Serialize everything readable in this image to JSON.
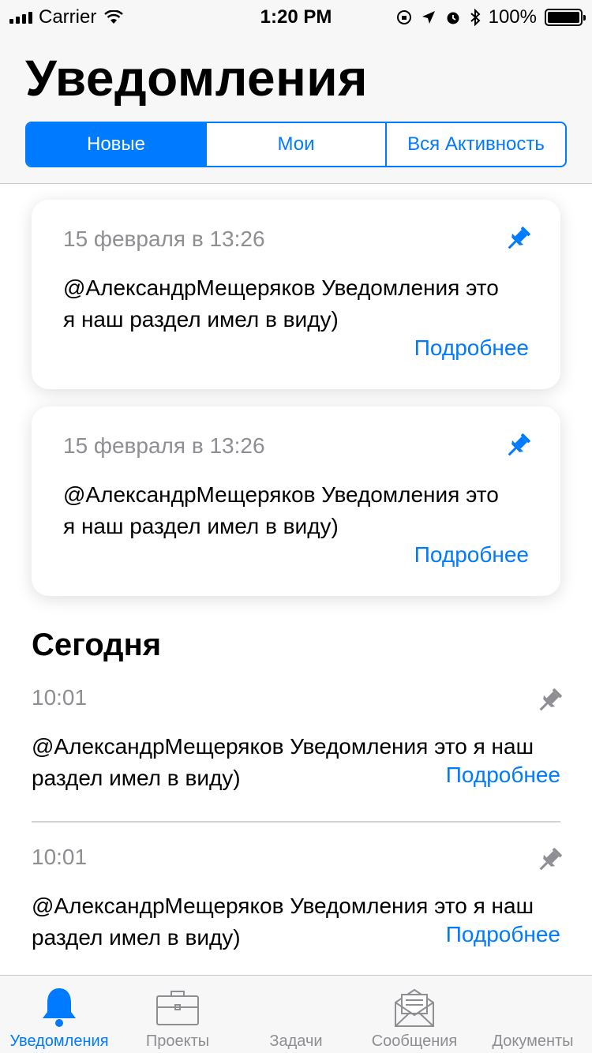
{
  "status_bar": {
    "carrier": "Carrier",
    "time": "1:20 PM",
    "battery": "100%"
  },
  "header": {
    "title": "Уведомления",
    "segments": [
      "Новые",
      "Мои",
      "Вся Активность"
    ],
    "active_segment": "Новые"
  },
  "pinned": [
    {
      "date": "15 февраля в 13:26",
      "text": "@АлександрМещеряков Уведомления это я наш раздел имел в виду)",
      "more": "Подробнее"
    },
    {
      "date": "15 февраля в 13:26",
      "text": "@АлександрМещеряков Уведомления это я наш раздел имел в виду)",
      "more": "Подробнее"
    }
  ],
  "section": {
    "title": "Сегодня"
  },
  "today": [
    {
      "time": "10:01",
      "text": "@АлександрМещеряков Уведомления это я наш раздел имел в виду)",
      "more": "Подробнее"
    },
    {
      "time": "10:01",
      "text": "@АлександрМещеряков Уведомления это я наш раздел имел в виду)",
      "more": "Подробнее"
    }
  ],
  "tabbar": {
    "tabs": [
      {
        "label": "Уведомления",
        "icon": "bell-icon",
        "active": true
      },
      {
        "label": "Проекты",
        "icon": "briefcase-icon",
        "active": false
      },
      {
        "label": "Задачи",
        "icon": "tasks-icon",
        "active": false
      },
      {
        "label": "Сообщения",
        "icon": "envelope-icon",
        "active": false
      },
      {
        "label": "Документы",
        "icon": "documents-icon",
        "active": false
      }
    ]
  },
  "colors": {
    "accent": "#007aff",
    "secondary_text": "#8e8e93",
    "pin_inactive": "#8e8e93"
  }
}
